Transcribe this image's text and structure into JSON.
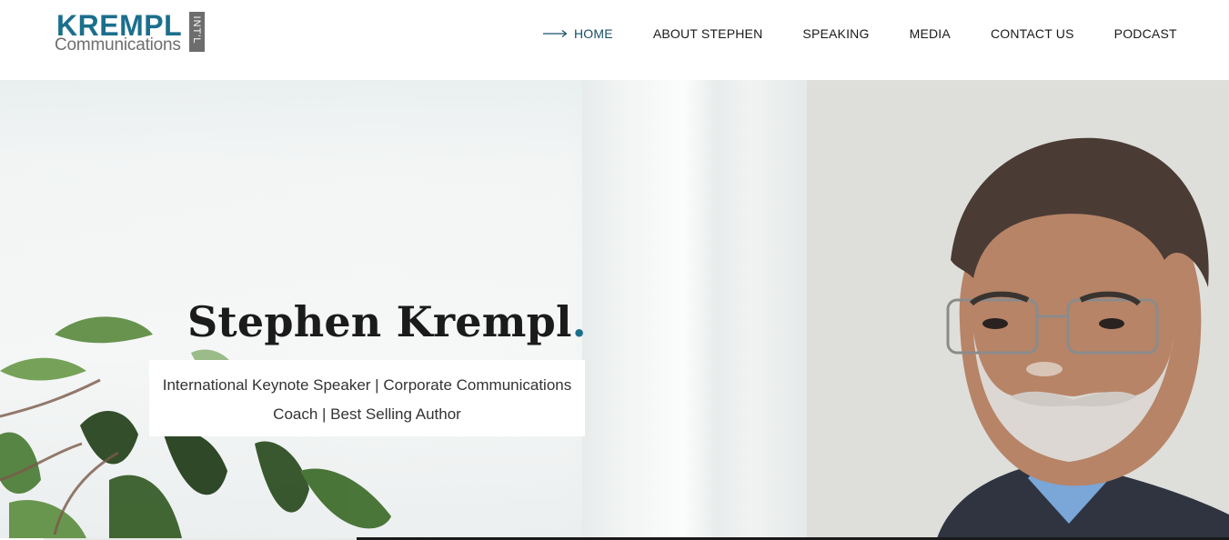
{
  "brand": {
    "logo_main": "KREMPL",
    "logo_sub": "Communications",
    "logo_tag": "INT'L",
    "accent_color": "#1b6f8c",
    "logo_grey": "#6e6e6e"
  },
  "nav": {
    "items": [
      {
        "label": "HOME",
        "active": true,
        "icon": "long-arrow-right-icon"
      },
      {
        "label": "ABOUT STEPHEN",
        "active": false
      },
      {
        "label": "SPEAKING",
        "active": false
      },
      {
        "label": "MEDIA",
        "active": false
      },
      {
        "label": "CONTACT US",
        "active": false
      },
      {
        "label": "PODCAST",
        "active": false
      }
    ]
  },
  "hero": {
    "title": "Stephen Krempl",
    "title_dot": ".",
    "subtitle_line1": "International Keynote Speaker | Corporate Communications",
    "subtitle_line2": "Coach | Best Selling Author"
  }
}
